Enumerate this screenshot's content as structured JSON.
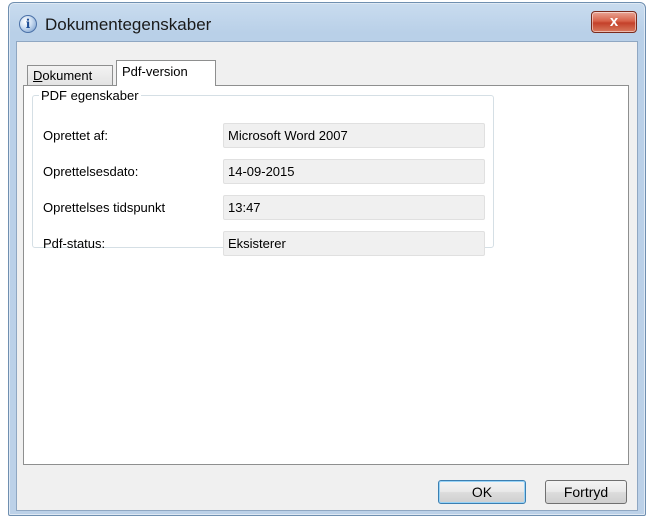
{
  "window": {
    "title": "Dokumentegenskaber",
    "close_glyph": "x"
  },
  "tabs": [
    {
      "label_underlined": "D",
      "label_rest": "okument",
      "selected": false
    },
    {
      "label": "Pdf-version",
      "selected": true
    }
  ],
  "group": {
    "legend": "PDF egenskaber",
    "rows": [
      {
        "label": "Oprettet af:",
        "value": "Microsoft Word 2007"
      },
      {
        "label": "Oprettelsesdato:",
        "value": "14-09-2015"
      },
      {
        "label": "Oprettelses tidspunkt",
        "value": "13:47"
      },
      {
        "label": "Pdf-status:",
        "value": "Eksisterer"
      }
    ]
  },
  "buttons": {
    "ok": "OK",
    "cancel": "Fortryd"
  },
  "icons": {
    "title_icon": "info-icon",
    "close_icon": "close-icon"
  }
}
